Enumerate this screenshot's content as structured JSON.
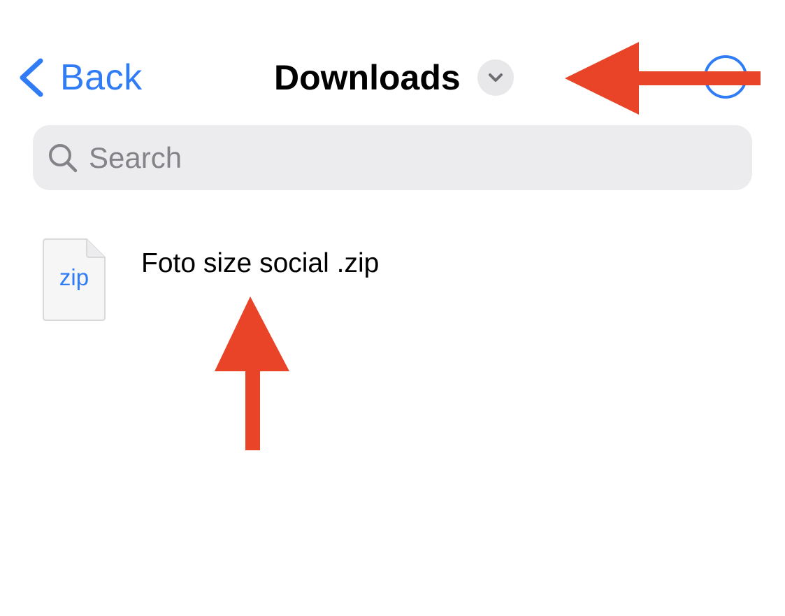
{
  "nav": {
    "back_label": "Back",
    "title": "Downloads"
  },
  "search": {
    "placeholder": "Search"
  },
  "files": [
    {
      "name": "Foto size social .zip",
      "ext": "zip"
    }
  ],
  "colors": {
    "accent": "#2f7cf6",
    "annotation_arrow": "#e94328",
    "search_background": "#ececee"
  },
  "icons": {
    "back": "chevron-left-icon",
    "title_menu": "chevron-down-icon",
    "more": "circle-ellipsis-icon",
    "search": "magnifier-icon",
    "file": "zip-document-icon"
  }
}
